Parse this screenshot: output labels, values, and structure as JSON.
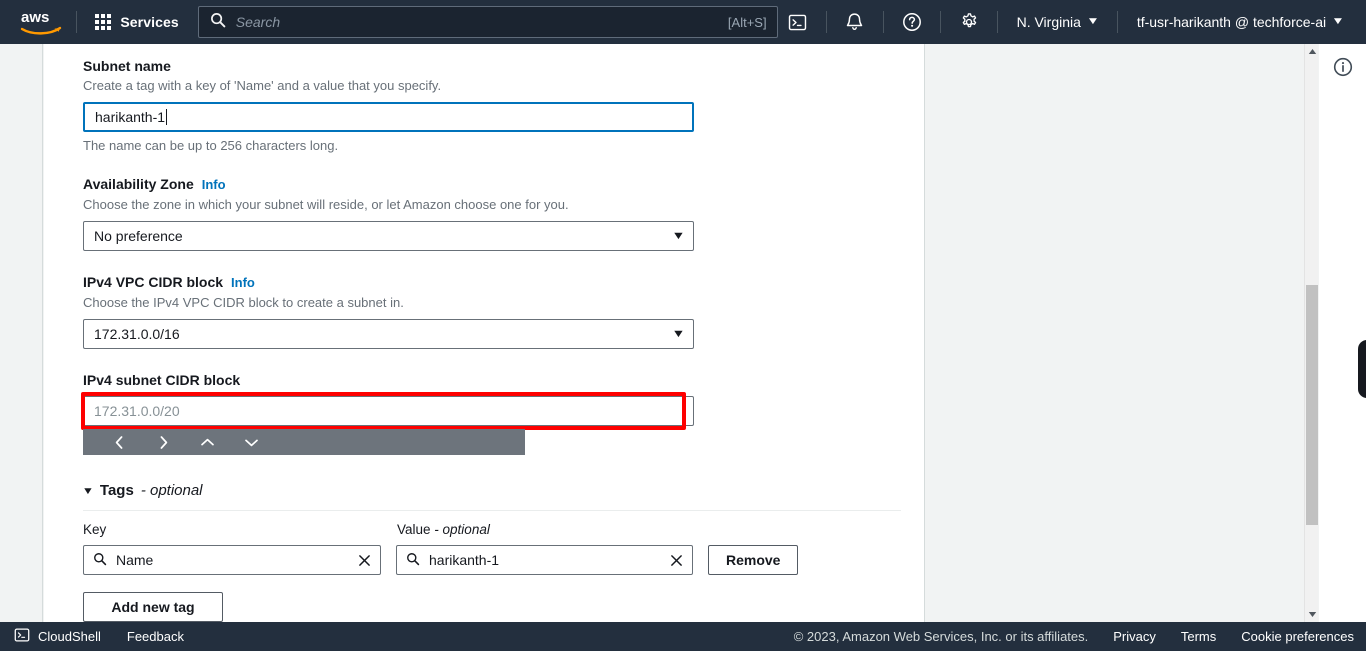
{
  "topnav": {
    "logo_alt": "aws",
    "services_label": "Services",
    "search": {
      "placeholder": "Search",
      "shortcut": "[Alt+S]",
      "icon": "search-icon"
    },
    "icons": {
      "cloudshell": "cloudshell-icon",
      "notifications": "bell-icon",
      "help": "question-circle-icon",
      "settings": "gear-icon"
    },
    "region": "N. Virginia",
    "account": "tf-usr-harikanth @ techforce-ai",
    "caret": "▼"
  },
  "form": {
    "subnet_name": {
      "label": "Subnet name",
      "description": "Create a tag with a key of 'Name' and a value that you specify.",
      "value": "harikanth-1",
      "hint": "The name can be up to 256 characters long."
    },
    "availability_zone": {
      "label": "Availability Zone",
      "info": "Info",
      "description": "Choose the zone in which your subnet will reside, or let Amazon choose one for you.",
      "selected": "No preference",
      "caret": "▼"
    },
    "vpc_cidr": {
      "label": "IPv4 VPC CIDR block",
      "info": "Info",
      "description": "Choose the IPv4 VPC CIDR block to create a subnet in.",
      "selected": "172.31.0.0/16",
      "caret": "▼"
    },
    "subnet_cidr": {
      "label": "IPv4 subnet CIDR block",
      "placeholder": "172.31.0.0/20",
      "highlight_color": "#fe0000"
    },
    "nav_overlay": {
      "back": "‹",
      "forward": "›",
      "up": "⌃",
      "down": "⌄"
    }
  },
  "tags": {
    "heading": "Tags",
    "heading_optional": "- optional",
    "triangle": "▼",
    "key_label": "Key",
    "value_label": "Value",
    "value_optional": "- optional",
    "rows": [
      {
        "key": "Name",
        "value": "harikanth-1",
        "remove_label": "Remove"
      }
    ],
    "add_new_tag_label": "Add new tag"
  },
  "footer": {
    "cloudshell": "CloudShell",
    "feedback": "Feedback",
    "copyright": "© 2023, Amazon Web Services, Inc. or its affiliates.",
    "privacy": "Privacy",
    "terms": "Terms",
    "cookie_preferences": "Cookie preferences"
  }
}
